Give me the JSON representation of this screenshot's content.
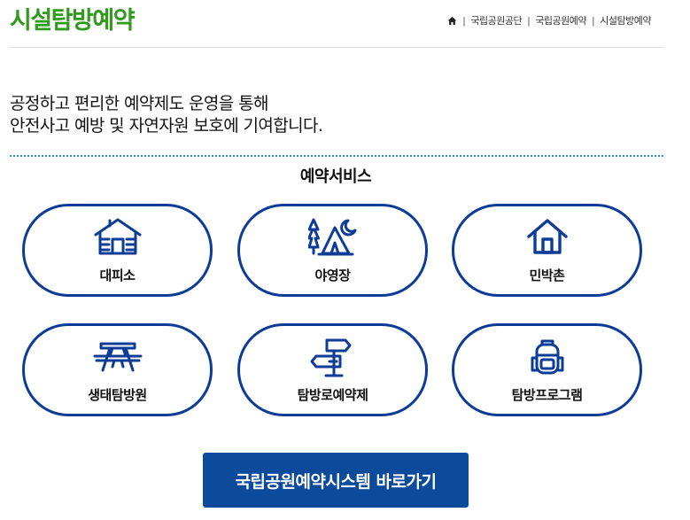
{
  "header": {
    "title": "시설탐방예약",
    "breadcrumb": [
      "국립공원공단",
      "국립공원예약",
      "시설탐방예약"
    ]
  },
  "intro": {
    "line1": "공정하고 편리한 예약제도 운영을 통해",
    "line2": "안전사고 예방 및 자연자원 보호에 기여합니다."
  },
  "services": {
    "title": "예약서비스",
    "items": [
      {
        "label": "대피소",
        "icon": "cabin-icon"
      },
      {
        "label": "야영장",
        "icon": "tent-icon"
      },
      {
        "label": "민박촌",
        "icon": "house-icon"
      },
      {
        "label": "생태탐방원",
        "icon": "picnic-table-icon"
      },
      {
        "label": "탐방로예약제",
        "icon": "signpost-icon"
      },
      {
        "label": "탐방프로그램",
        "icon": "backpack-icon"
      }
    ]
  },
  "cta": {
    "label": "국립공원예약시스템 바로가기"
  },
  "colors": {
    "title": "#2f9a1c",
    "accent": "#0d3c96",
    "button": "#0c4a9c",
    "divider": "#2aa198"
  }
}
